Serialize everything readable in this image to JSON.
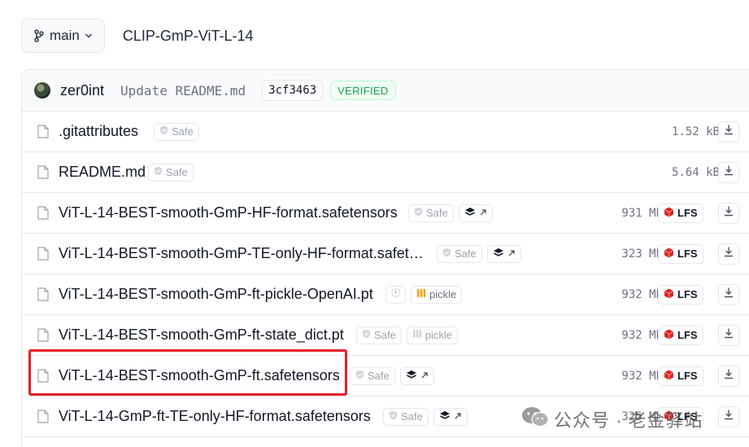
{
  "topbar": {
    "branch_label": "main",
    "repo_title": "CLIP-GmP-ViT-L-14"
  },
  "commit": {
    "author": "zer0int",
    "message": "Update README.md",
    "hash": "3cf3463",
    "verified_label": "VERIFIED"
  },
  "files": [
    {
      "name": ".gitattributes",
      "safe_label": "Safe",
      "size": "1.52 kB"
    },
    {
      "name": "README.md",
      "safe_label": "Safe",
      "size": "5.64 kB"
    },
    {
      "name": "ViT-L-14-BEST-smooth-GmP-HF-format.safetensors",
      "safe_label": "Safe",
      "size": "931 MB",
      "lfs_label": "LFS"
    },
    {
      "name": "ViT-L-14-BEST-smooth-GmP-TE-only-HF-format.safet…",
      "safe_label": "Safe",
      "size": "323 MB",
      "lfs_label": "LFS"
    },
    {
      "name": "ViT-L-14-BEST-smooth-GmP-ft-pickle-OpenAI.pt",
      "pickle_label": "pickle",
      "size": "932 MB",
      "lfs_label": "LFS"
    },
    {
      "name": "ViT-L-14-BEST-smooth-GmP-ft-state_dict.pt",
      "safe_label": "Safe",
      "pickle_label": "pickle",
      "size": "932 MB",
      "lfs_label": "LFS"
    },
    {
      "name": "ViT-L-14-BEST-smooth-GmP-ft.safetensors",
      "safe_label": "Safe",
      "size": "932 MB",
      "lfs_label": "LFS"
    },
    {
      "name": "ViT-L-14-GmP-ft-TE-only-HF-format.safetensors",
      "safe_label": "Safe",
      "size": "325 MB",
      "lfs_label": "LFS"
    }
  ],
  "watermark": {
    "text": "公众号 · 老金驿站"
  },
  "colors": {
    "highlight": "#e41e2b",
    "verified_green": "#16a34a",
    "lfs_red": "#dc2626"
  }
}
